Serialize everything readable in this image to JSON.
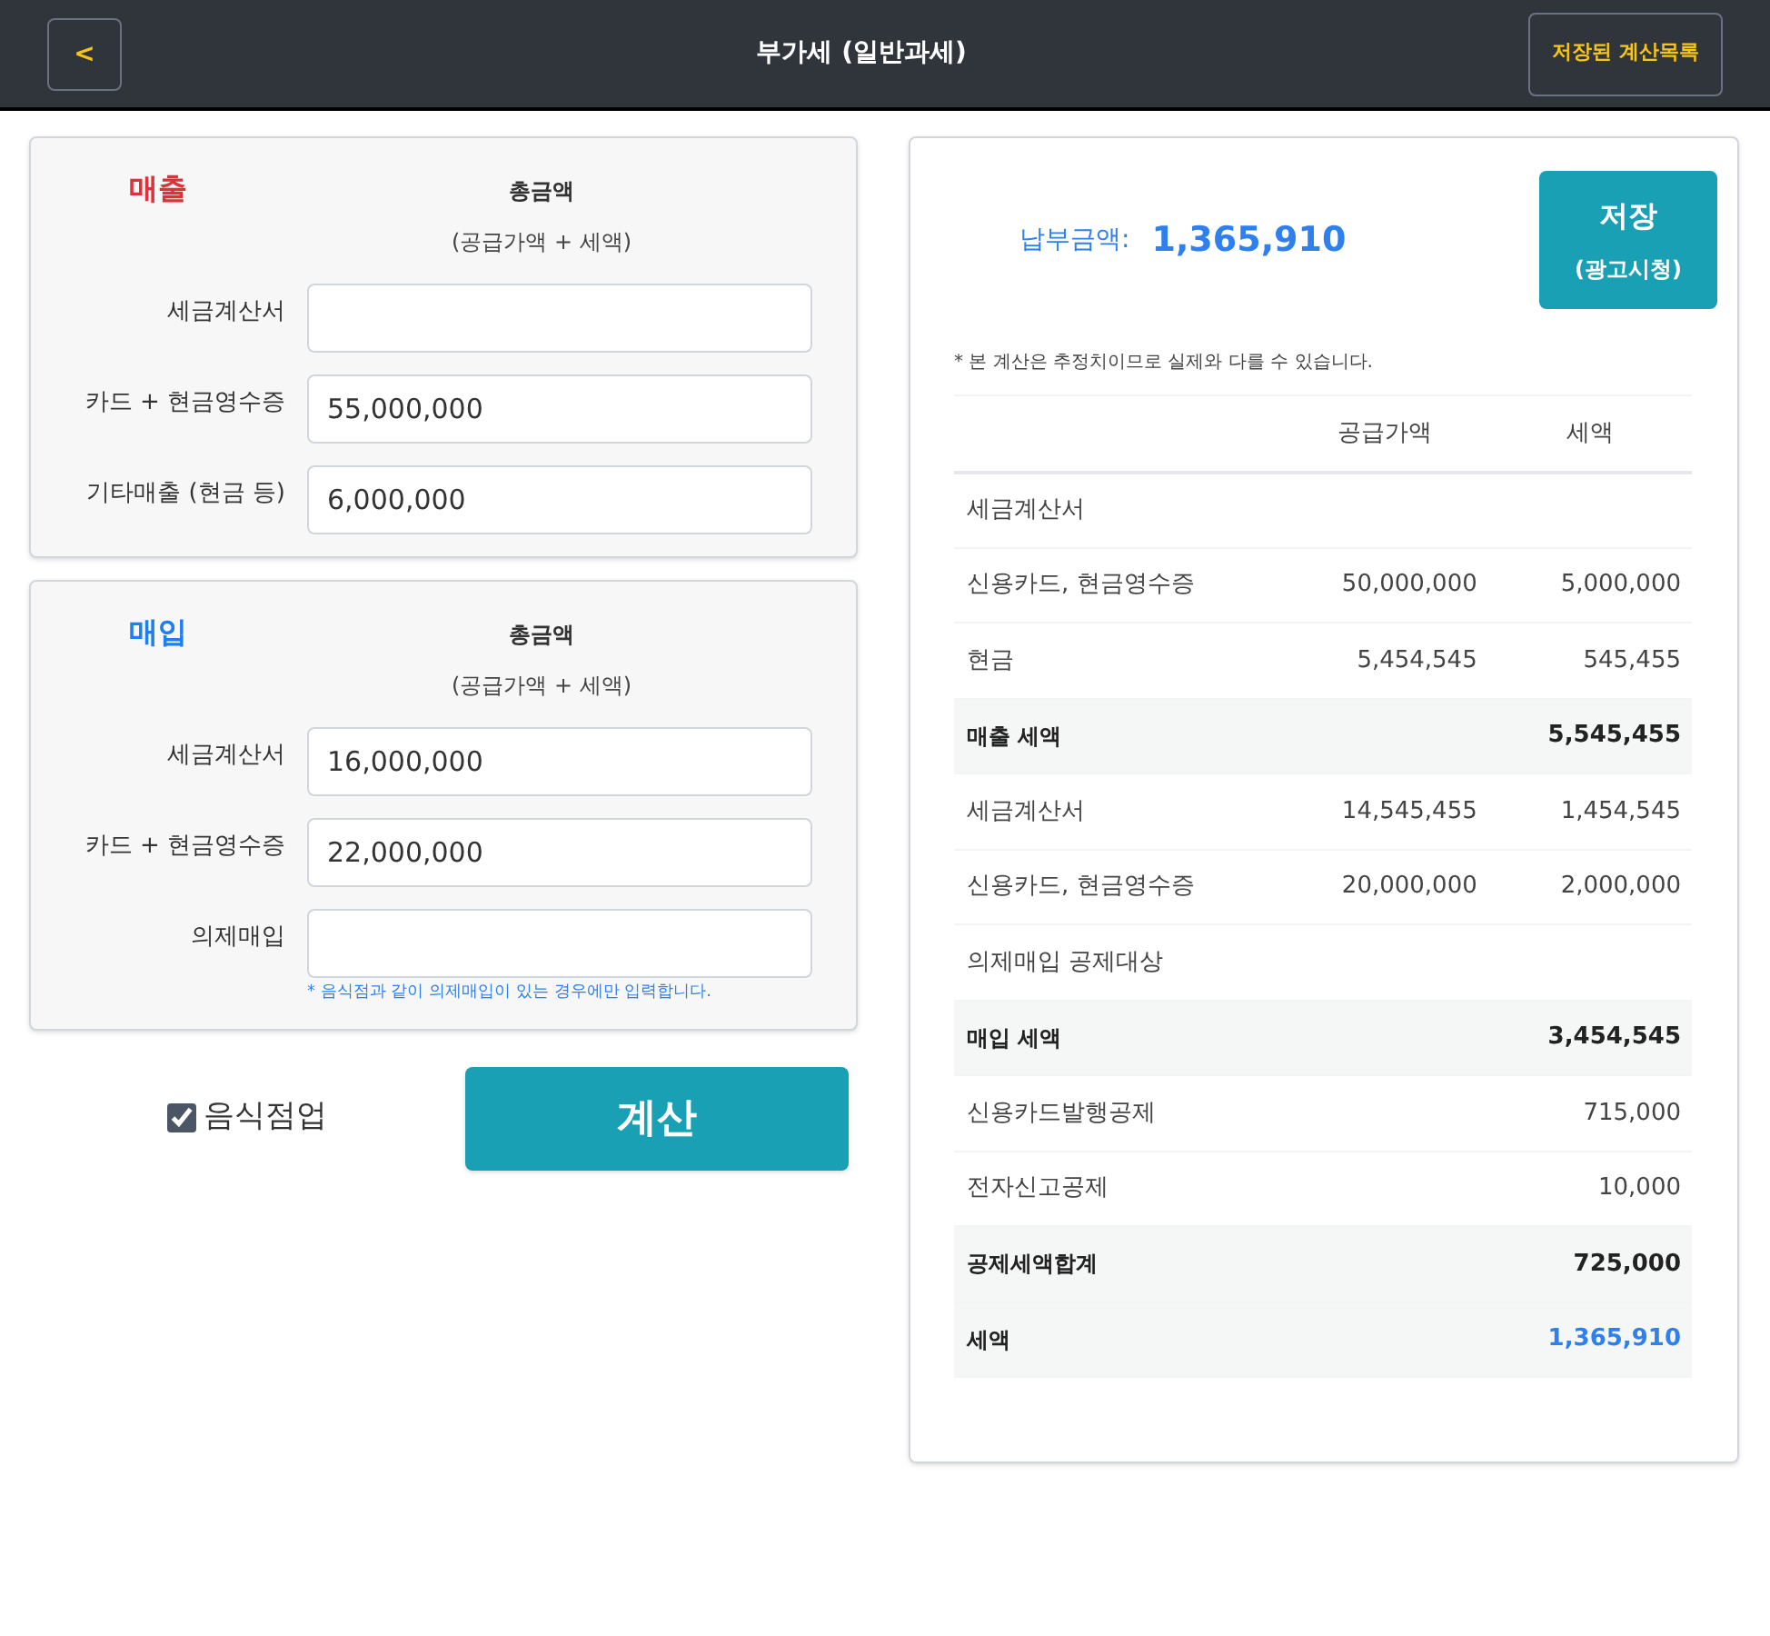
{
  "header": {
    "back": "<",
    "title": "부가세 (일반과세)",
    "saved_list": "저장된 계산목록"
  },
  "sections": [
    {
      "title": "매출",
      "kind": "sales",
      "total_label": "총금액",
      "total_sub": "(공급가액 + 세액)",
      "fields": [
        {
          "label": "세금계산서"
        },
        {
          "label": "카드 + 현금영수증",
          "value": "55,000,000"
        },
        {
          "label": "기타매출 (현금 등)",
          "value": "6,000,000"
        }
      ]
    },
    {
      "title": "매입",
      "kind": "purchase",
      "total_label": "총금액",
      "total_sub": "(공급가액 + 세액)",
      "fields": [
        {
          "label": "세금계산서",
          "value": "16,000,000"
        },
        {
          "label": "카드 + 현금영수증",
          "value": "22,000,000"
        },
        {
          "label": "의제매입",
          "note": "* 음식점과 같이 의제매입이 있는 경우에만 입력합니다."
        }
      ]
    }
  ],
  "restaurant": {
    "label": "음식점업",
    "checked": true
  },
  "calculate": "계산",
  "result": {
    "label": "납부금액:",
    "amount": "1,365,910",
    "save": "저장",
    "save_sub": "(광고시청)",
    "notice": "* 본 계산은 추정치이므로 실제와 다를 수 있습니다.",
    "columns": [
      "공급가액",
      "세액"
    ],
    "rows": [
      {
        "kind": "plain",
        "label": "세금계산서"
      },
      {
        "kind": "plain",
        "label": "신용카드, 현금영수증",
        "supply": "50,000,000",
        "tax": "5,000,000"
      },
      {
        "kind": "plain",
        "label": "현금",
        "supply": "5,454,545",
        "tax": "545,455"
      },
      {
        "kind": "total",
        "label": "매출 세액",
        "tax": "5,545,455"
      },
      {
        "kind": "plain",
        "label": "세금계산서",
        "supply": "14,545,455",
        "tax": "1,454,545"
      },
      {
        "kind": "plain",
        "label": "신용카드, 현금영수증",
        "supply": "20,000,000",
        "tax": "2,000,000"
      },
      {
        "kind": "plain",
        "label": "의제매입 공제대상"
      },
      {
        "kind": "total",
        "label": "매입 세액",
        "tax": "3,454,545"
      },
      {
        "kind": "plain",
        "label": "신용카드발행공제",
        "tax": "715,000"
      },
      {
        "kind": "plain",
        "label": "전자신고공제",
        "tax": "10,000"
      },
      {
        "kind": "total",
        "label": "공제세액합계",
        "tax": "725,000"
      },
      {
        "kind": "final",
        "label": "세액",
        "tax": "1,365,910"
      }
    ]
  }
}
